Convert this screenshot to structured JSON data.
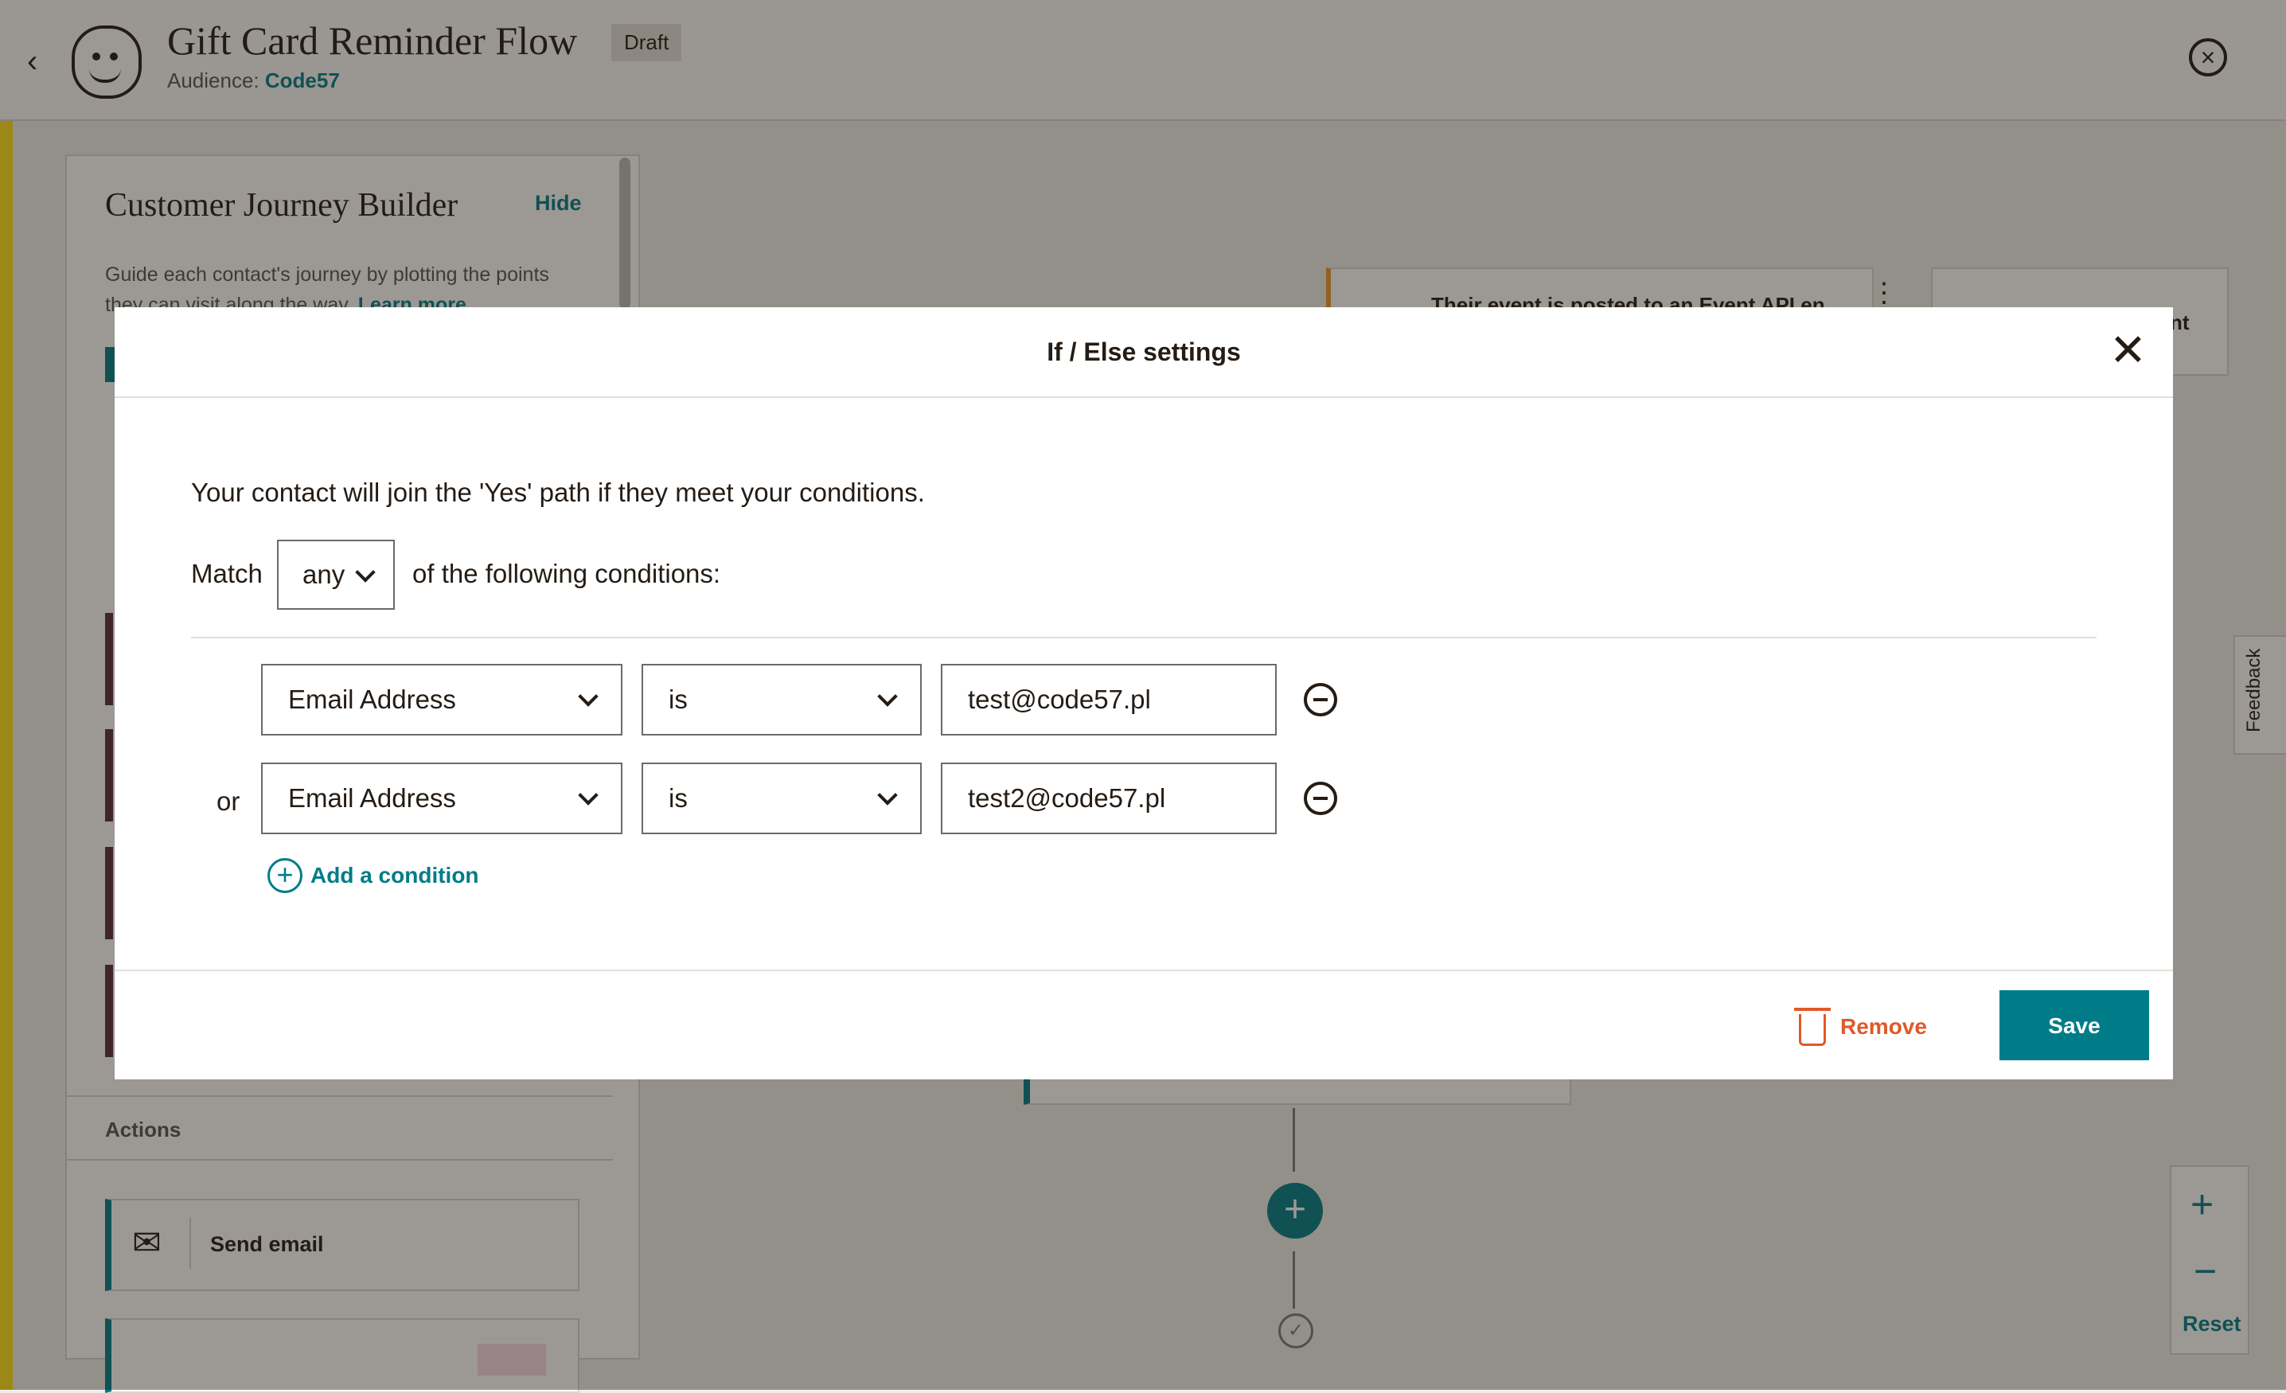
{
  "header": {
    "title": "Gift Card Reminder Flow",
    "status_badge": "Draft",
    "audience_label": "Audience:",
    "audience_name": "Code57"
  },
  "sidebar": {
    "title": "Customer Journey Builder",
    "hide_label": "Hide",
    "description": "Guide each contact's journey by plotting the points they can visit along the way.",
    "learn_more": "Learn more",
    "actions_heading": "Actions",
    "send_email_label": "Send email"
  },
  "canvas": {
    "event_card_text": "Their event is posted to an Event API en",
    "event_card2_text": "nt",
    "zoom_reset": "Reset",
    "feedback_label": "Feedback"
  },
  "modal": {
    "title": "If / Else settings",
    "description": "Your contact will join the 'Yes' path if they meet your conditions.",
    "match_label": "Match",
    "match_value": "any",
    "following_label": "of the following conditions:",
    "conditions": [
      {
        "prefix": "",
        "field": "Email Address",
        "operator": "is",
        "value": "test@code57.pl"
      },
      {
        "prefix": "or",
        "field": "Email Address",
        "operator": "is",
        "value": "test2@code57.pl"
      }
    ],
    "add_condition_label": "Add a condition",
    "remove_label": "Remove",
    "save_label": "Save"
  },
  "colors": {
    "accent": "#007c89",
    "danger": "#e0592a",
    "brand_yellow": "#ffe01b"
  },
  "icons": [
    "back-chevron-icon",
    "mailchimp-logo-icon",
    "close-circle-icon",
    "close-x-icon",
    "chevron-down-icon",
    "minus-circle-icon",
    "plus-circle-icon",
    "trash-icon",
    "envelope-icon",
    "plus-icon",
    "check-circle-icon"
  ]
}
